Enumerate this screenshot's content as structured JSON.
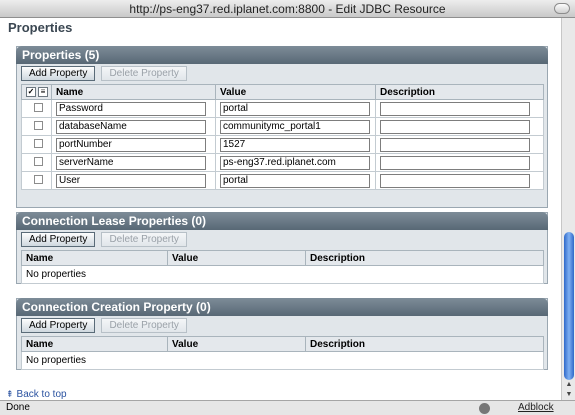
{
  "window": {
    "title": "http://ps-eng37.red.iplanet.com:8800 - Edit JDBC Resource"
  },
  "page": {
    "title": "Properties"
  },
  "properties": {
    "title": "Properties (5)",
    "add_label": "Add Property",
    "delete_label": "Delete Property",
    "columns": [
      "Name",
      "Value",
      "Description"
    ],
    "rows": [
      {
        "name": "Password",
        "value": "portal",
        "description": ""
      },
      {
        "name": "databaseName",
        "value": "communitymc_portal1",
        "description": ""
      },
      {
        "name": "portNumber",
        "value": "1527",
        "description": ""
      },
      {
        "name": "serverName",
        "value": "ps-eng37.red.iplanet.com",
        "description": ""
      },
      {
        "name": "User",
        "value": "portal",
        "description": ""
      }
    ]
  },
  "lease": {
    "title": "Connection Lease Properties (0)",
    "add_label": "Add Property",
    "delete_label": "Delete Property",
    "columns": [
      "Name",
      "Value",
      "Description"
    ],
    "empty": "No properties"
  },
  "creation": {
    "title": "Connection Creation Property (0)",
    "add_label": "Add Property",
    "delete_label": "Delete Property",
    "columns": [
      "Name",
      "Value",
      "Description"
    ],
    "empty": "No properties"
  },
  "footer": {
    "back_to_top": "Back to top"
  },
  "status": {
    "text": "Done",
    "adblock": "Adblock"
  }
}
